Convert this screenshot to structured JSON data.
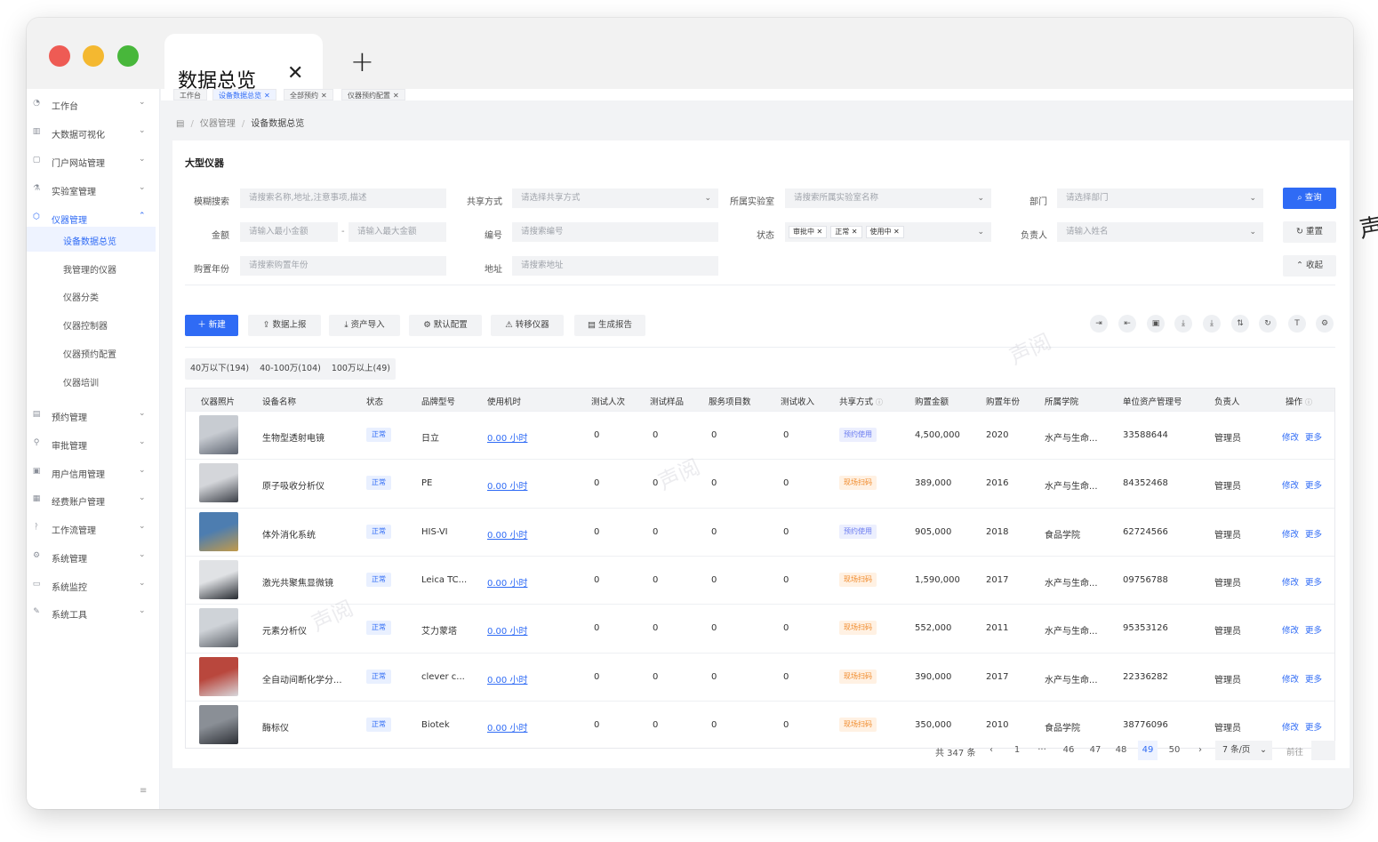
{
  "browser": {
    "tab_title": "数据总览",
    "tab_close": "✕",
    "new_tab": "+"
  },
  "sidebar": {
    "items": [
      {
        "label": "工作台",
        "icon": "dashboard-icon",
        "glyph": "◔"
      },
      {
        "label": "大数据可视化",
        "icon": "chart-icon",
        "glyph": "▥"
      },
      {
        "label": "门户网站管理",
        "icon": "page-icon",
        "glyph": "▢"
      },
      {
        "label": "实验室管理",
        "icon": "flask-icon",
        "glyph": "⚗"
      },
      {
        "label": "仪器管理",
        "icon": "cube-icon",
        "glyph": "⬡"
      },
      {
        "label": "预约管理",
        "icon": "calendar-icon",
        "glyph": "▤"
      },
      {
        "label": "审批管理",
        "icon": "user-icon",
        "glyph": "⚲"
      },
      {
        "label": "用户信用管理",
        "icon": "credit-icon",
        "glyph": "▣"
      },
      {
        "label": "经费账户管理",
        "icon": "wallet-icon",
        "glyph": "▦"
      },
      {
        "label": "工作流管理",
        "icon": "workflow-icon",
        "glyph": "ᚹ"
      },
      {
        "label": "系统管理",
        "icon": "gear-icon",
        "glyph": "⚙"
      },
      {
        "label": "系统监控",
        "icon": "monitor-icon",
        "glyph": "▭"
      },
      {
        "label": "系统工具",
        "icon": "wrench-icon",
        "glyph": "✎"
      }
    ],
    "sub_items": [
      "设备数据总览",
      "我管理的仪器",
      "仪器分类",
      "仪器控制器",
      "仪器预约配置",
      "仪器培训"
    ],
    "collapse_glyph": "≡"
  },
  "page_tags": [
    {
      "label": "工作台",
      "closable": false
    },
    {
      "label": "设备数据总览",
      "closable": true
    },
    {
      "label": "全部预约",
      "closable": true
    },
    {
      "label": "仪器预约配置",
      "closable": true
    }
  ],
  "breadcrumb": {
    "home": "▤",
    "parent": "仪器管理",
    "current": "设备数据总览",
    "sep": "/"
  },
  "panel": {
    "title": "大型仪器"
  },
  "filters": {
    "fuzzy": {
      "label": "模糊搜索",
      "placeholder": "请搜索名称,地址,注意事项,描述"
    },
    "share": {
      "label": "共享方式",
      "placeholder": "请选择共享方式"
    },
    "lab": {
      "label": "所属实验室",
      "placeholder": "请搜索所属实验室名称"
    },
    "dept": {
      "label": "部门",
      "placeholder": "请选择部门"
    },
    "amount": {
      "label": "金额",
      "min_placeholder": "请输入最小金额",
      "max_placeholder": "请输入最大金额",
      "dash": "-"
    },
    "code": {
      "label": "编号",
      "placeholder": "请搜索编号"
    },
    "status": {
      "label": "状态",
      "chips": [
        "审批中",
        "正常",
        "使用中"
      ]
    },
    "owner": {
      "label": "负责人",
      "placeholder": "请输入姓名"
    },
    "year": {
      "label": "购置年份",
      "placeholder": "请搜索购置年份"
    },
    "address": {
      "label": "地址",
      "placeholder": "请搜索地址"
    },
    "search_btn": "查询",
    "reset_btn": "重置",
    "collapse_btn": "收起"
  },
  "toolbar": {
    "new_btn": "新建",
    "actions": [
      "数据上报",
      "资产导入",
      "默认配置",
      "转移仪器",
      "生成报告"
    ],
    "action_icons": [
      "upload-icon",
      "download-icon",
      "settings-icon",
      "transfer-icon",
      "report-icon"
    ],
    "action_glyphs": [
      "⇪",
      "⤓",
      "⚙",
      "⚠",
      "▤"
    ],
    "right_icons": [
      "export-icon",
      "import-icon",
      "print-icon",
      "download-icon",
      "download-all-icon",
      "sort-icon",
      "refresh-icon",
      "text-size-icon",
      "settings-icon"
    ],
    "right_glyphs": [
      "⇥",
      "⇤",
      "▣",
      "⤓",
      "⤓",
      "⇅",
      "↻",
      "T",
      "⚙"
    ]
  },
  "segments": [
    "40万以下(194)",
    "40-100万(104)",
    "100万以上(49)"
  ],
  "table": {
    "headers": [
      "仪器照片",
      "设备名称",
      "状态",
      "品牌型号",
      "使用机时",
      "测试人次",
      "测试样品",
      "服务项目数",
      "测试收入",
      "共享方式",
      "购置金额",
      "购置年份",
      "所属学院",
      "单位资产管理号",
      "负责人",
      "操作"
    ],
    "rows": [
      {
        "name": "生物型透射电镜",
        "status": "正常",
        "brand": "日立",
        "hours": "0.00 小时",
        "people": "0",
        "samples": "0",
        "services": "0",
        "income": "0",
        "share": "预约使用",
        "share_type": "b",
        "amount": "4,500,000",
        "year": "2020",
        "college": "水产与生命...",
        "asset_no": "33588644",
        "owner": "管理员",
        "edit": "修改",
        "more": "更多"
      },
      {
        "name": "原子吸收分析仪",
        "status": "正常",
        "brand": "PE",
        "hours": "0.00 小时",
        "people": "0",
        "samples": "0",
        "services": "0",
        "income": "0",
        "share": "现场扫码",
        "share_type": "o",
        "amount": "389,000",
        "year": "2016",
        "college": "水产与生命...",
        "asset_no": "84352468",
        "owner": "管理员",
        "edit": "修改",
        "more": "更多"
      },
      {
        "name": "体外消化系统",
        "status": "正常",
        "brand": "HIS-VI",
        "hours": "0.00 小时",
        "people": "0",
        "samples": "0",
        "services": "0",
        "income": "0",
        "share": "预约使用",
        "share_type": "b",
        "amount": "905,000",
        "year": "2018",
        "college": "食品学院",
        "asset_no": "62724566",
        "owner": "管理员",
        "edit": "修改",
        "more": "更多"
      },
      {
        "name": "激光共聚焦显微镜",
        "status": "正常",
        "brand": "Leica TC...",
        "hours": "0.00 小时",
        "people": "0",
        "samples": "0",
        "services": "0",
        "income": "0",
        "share": "现场扫码",
        "share_type": "o",
        "amount": "1,590,000",
        "year": "2017",
        "college": "水产与生命...",
        "asset_no": "09756788",
        "owner": "管理员",
        "edit": "修改",
        "more": "更多"
      },
      {
        "name": "元素分析仪",
        "status": "正常",
        "brand": "艾力蒙塔",
        "hours": "0.00 小时",
        "people": "0",
        "samples": "0",
        "services": "0",
        "income": "0",
        "share": "现场扫码",
        "share_type": "o",
        "amount": "552,000",
        "year": "2011",
        "college": "水产与生命...",
        "asset_no": "95353126",
        "owner": "管理员",
        "edit": "修改",
        "more": "更多"
      },
      {
        "name": "全自动间断化学分...",
        "status": "正常",
        "brand": "clever c...",
        "hours": "0.00 小时",
        "people": "0",
        "samples": "0",
        "services": "0",
        "income": "0",
        "share": "现场扫码",
        "share_type": "o",
        "amount": "390,000",
        "year": "2017",
        "college": "水产与生命...",
        "asset_no": "22336282",
        "owner": "管理员",
        "edit": "修改",
        "more": "更多"
      },
      {
        "name": "酶标仪",
        "status": "正常",
        "brand": "Biotek",
        "hours": "0.00 小时",
        "people": "0",
        "samples": "0",
        "services": "0",
        "income": "0",
        "share": "现场扫码",
        "share_type": "o",
        "amount": "350,000",
        "year": "2010",
        "college": "食品学院",
        "asset_no": "38776096",
        "owner": "管理员",
        "edit": "修改",
        "more": "更多"
      }
    ]
  },
  "pagination": {
    "total": "共 347 条",
    "prev": "‹",
    "next": "›",
    "pages": [
      "1",
      "···",
      "46",
      "47",
      "48",
      "49",
      "50"
    ],
    "current": "49",
    "page_size": "7 条/页",
    "goto": "前往"
  },
  "watermark": "声阅",
  "edge_char": "声",
  "colors": {
    "primary": "#2f6bf5",
    "orange": "#f08a2a"
  }
}
